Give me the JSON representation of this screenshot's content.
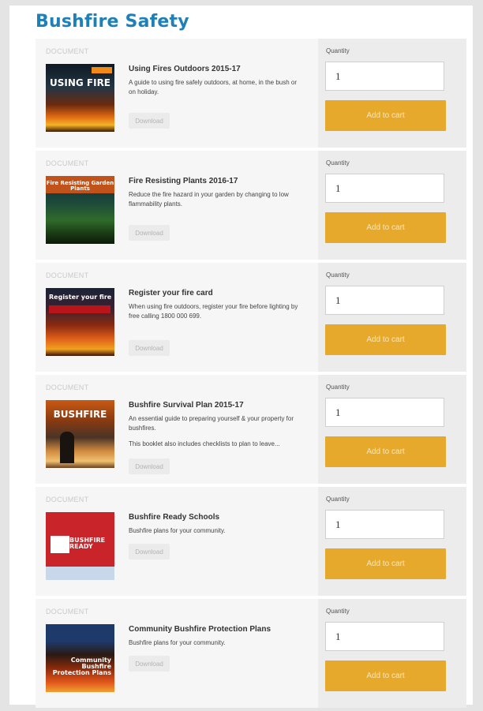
{
  "page": {
    "title": "Bushfire Safety"
  },
  "labels": {
    "document": "DOCUMENT",
    "quantity": "Quantity",
    "download": "Download",
    "add_to_cart": "Add to cart"
  },
  "colors": {
    "title": "#1f80b8",
    "cart_button": "#e7a92c",
    "item_left_bg": "#f6f6f6",
    "item_right_bg": "#ececec"
  },
  "items": [
    {
      "title": "Using Fires Outdoors 2015-17",
      "desc": [
        "A guide to using fire safely outdoors, at home, in the bush or on holiday."
      ],
      "quantity": "1",
      "cover_text": "USING FIRE"
    },
    {
      "title": "Fire Resisting Plants 2016-17",
      "desc": [
        "Reduce the fire hazard in your garden by changing to low flammability plants."
      ],
      "quantity": "1",
      "cover_text": "Fire Resisting Garden Plants"
    },
    {
      "title": "Register your fire card",
      "desc": [
        "When using fire outdoors, register your fire before lighting by free calling 1800 000 699."
      ],
      "quantity": "1",
      "cover_text": "Register your fire"
    },
    {
      "title": "Bushfire Survival Plan 2015-17",
      "desc": [
        "An essential guide to preparing yourself & your property for bushfires.",
        "This booklet also includes checklists to plan to leave..."
      ],
      "quantity": "1",
      "cover_text": "BUSHFIRE"
    },
    {
      "title": "Bushfire Ready Schools",
      "desc": [
        "Bushfire plans for your community."
      ],
      "quantity": "1",
      "cover_text": "BUSHFIRE READY"
    },
    {
      "title": "Community Bushfire Protection Plans",
      "desc": [
        "Bushfire plans for your community."
      ],
      "quantity": "1",
      "cover_text": "Community Bushfire Protection Plans"
    }
  ]
}
